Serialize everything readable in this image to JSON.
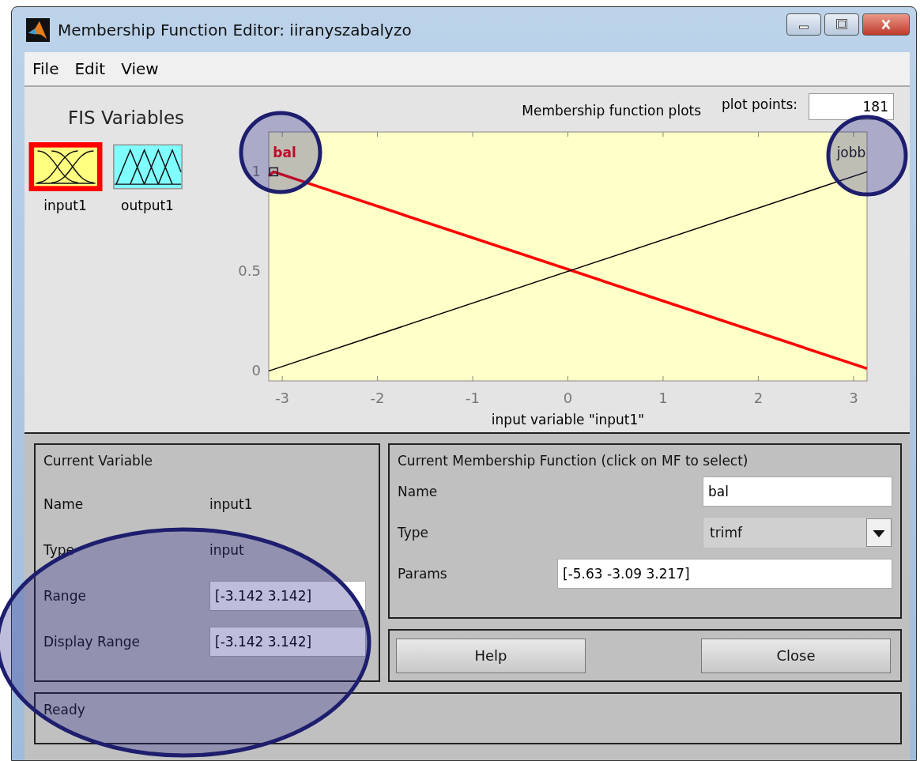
{
  "window": {
    "title": "Membership Function Editor: iiranyszabalyzo"
  },
  "menu": [
    "File",
    "Edit",
    "View"
  ],
  "fis_variables": {
    "title": "FIS Variables",
    "items": [
      {
        "label": "input1",
        "kind": "input",
        "selected": true
      },
      {
        "label": "output1",
        "kind": "output",
        "selected": false
      }
    ]
  },
  "plot_header": {
    "title": "Membership function plots",
    "plot_points_label": "plot points:",
    "plot_points": "181"
  },
  "chart_data": {
    "type": "line",
    "xlabel": "input variable \"input1\"",
    "x": [
      -3.142,
      -3.09,
      3.142
    ],
    "series": [
      {
        "name": "bal",
        "color": "#ff0000",
        "values": [
          0.98,
          1,
          0.012
        ]
      },
      {
        "name": "jobb",
        "color": "#000000",
        "values": [
          0,
          0.008,
          1
        ]
      }
    ],
    "xlim": [
      -3.142,
      3.142
    ],
    "ylim": [
      -0.05,
      1.2
    ],
    "xticks": [
      -3,
      -2,
      -1,
      0,
      1,
      2,
      3
    ],
    "yticks": [
      0,
      0.5,
      1
    ]
  },
  "mf_states": [
    {
      "selected": true
    },
    {
      "selected": false
    }
  ],
  "current_variable": {
    "title": "Current Variable",
    "name_label": "Name",
    "name": "input1",
    "type_label": "Type",
    "type": "input",
    "range_label": "Range",
    "range": "[-3.142 3.142]",
    "display_range_label": "Display Range",
    "display_range": "[-3.142 3.142]"
  },
  "current_mf": {
    "title": "Current Membership Function (click on MF to select)",
    "name_label": "Name",
    "name": "bal",
    "type_label": "Type",
    "type": "trimf",
    "params_label": "Params",
    "params": "[-5.63 -3.09 3.217]"
  },
  "buttons": [
    "Help",
    "Close"
  ],
  "status_bar": "Ready"
}
